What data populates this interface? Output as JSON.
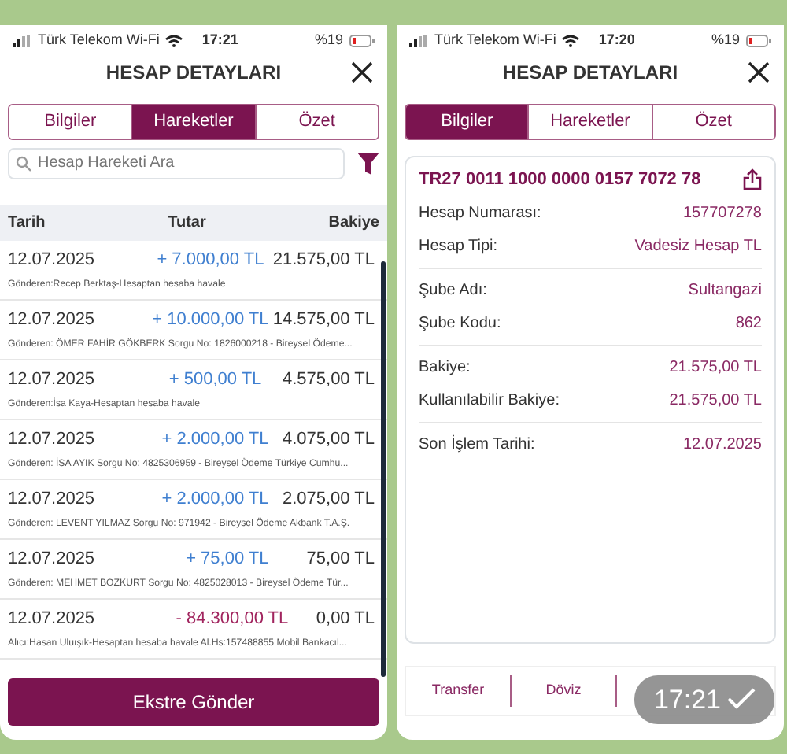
{
  "left_screen": {
    "status_bar": {
      "carrier": "Türk Telekom Wi-Fi",
      "time": "17:21",
      "battery": "%19"
    },
    "title": "HESAP DETAYLARI",
    "tabs": [
      {
        "label": "Bilgiler",
        "selected": false
      },
      {
        "label": "Hareketler",
        "selected": true
      },
      {
        "label": "Özet",
        "selected": false
      }
    ],
    "search": {
      "placeholder": "Hesap Hareketi Ara"
    },
    "table": {
      "columns": [
        "Tarih",
        "Tutar",
        "Bakiye"
      ],
      "rows": [
        {
          "date": "12.07.2025",
          "amount": "+ 7.000,00 TL",
          "balance": "21.575,00 TL",
          "description": "Gönderen:Recep Berktaş-Hesaptan hesaba havale",
          "kind": "credit"
        },
        {
          "date": "12.07.2025",
          "amount": "+ 10.000,00 TL",
          "balance": "14.575,00 TL",
          "description": "Gönderen: ÖMER FAHİR GÖKBERK Sorgu No: 1826000218 - Bireysel Ödeme...",
          "kind": "credit"
        },
        {
          "date": "12.07.2025",
          "amount": "+ 500,00 TL",
          "balance": "4.575,00 TL",
          "description": "Gönderen:İsa Kaya-Hesaptan hesaba havale",
          "kind": "credit"
        },
        {
          "date": "12.07.2025",
          "amount": "+ 2.000,00 TL",
          "balance": "4.075,00 TL",
          "description": "Gönderen: İSA AYIK Sorgu No: 4825306959 - Bireysel Ödeme Türkiye Cumhu...",
          "kind": "credit"
        },
        {
          "date": "12.07.2025",
          "amount": "+ 2.000,00 TL",
          "balance": "2.075,00 TL",
          "description": "Gönderen: LEVENT YILMAZ Sorgu No: 971942 - Bireysel Ödeme Akbank T.A.Ş.",
          "kind": "credit"
        },
        {
          "date": "12.07.2025",
          "amount": "+ 75,00 TL",
          "balance": "75,00 TL",
          "description": "Gönderen: MEHMET BOZKURT Sorgu No: 4825028013 - Bireysel Ödeme Tür...",
          "kind": "credit"
        },
        {
          "date": "12.07.2025",
          "amount": "- 84.300,00 TL",
          "balance": "0,00 TL",
          "description": "Alıcı:Hasan Uluışık-Hesaptan hesaba havale Al.Hs:157488855 Mobil Bankacıl...",
          "kind": "debit"
        }
      ]
    },
    "button": "Ekstre Gönder"
  },
  "right_screen": {
    "status_bar": {
      "carrier": "Türk Telekom Wi-Fi",
      "time": "17:20",
      "battery": "%19"
    },
    "title": "HESAP DETAYLARI",
    "tabs": [
      {
        "label": "Bilgiler",
        "selected": true
      },
      {
        "label": "Hareketler",
        "selected": false
      },
      {
        "label": "Özet",
        "selected": false
      }
    ],
    "iban": "TR27 0011 1000 0000 0157 7072 78",
    "groups": [
      [
        {
          "label": "Hesap Numarası:",
          "value": "157707278"
        },
        {
          "label": "Hesap Tipi:",
          "value": "Vadesiz Hesap TL"
        }
      ],
      [
        {
          "label": "Şube Adı:",
          "value": "Sultangazi"
        },
        {
          "label": "Şube Kodu:",
          "value": "862"
        }
      ],
      [
        {
          "label": "Bakiye:",
          "value": "21.575,00 TL"
        },
        {
          "label": "Kullanılabilir Bakiye:",
          "value": "21.575,00 TL"
        }
      ],
      [
        {
          "label": "Son İşlem Tarihi:",
          "value": "12.07.2025"
        }
      ]
    ],
    "actions": [
      "Transfer",
      "Döviz"
    ]
  },
  "message_time": "17:21"
}
